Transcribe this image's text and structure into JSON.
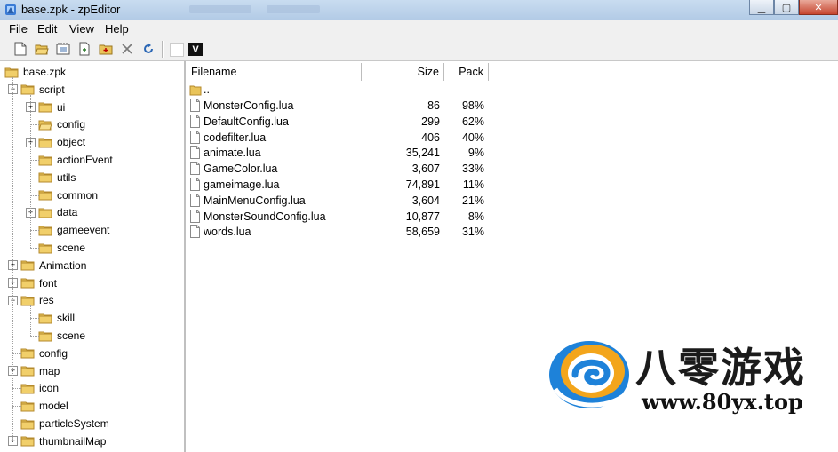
{
  "window": {
    "title": "base.zpk - zpEditor"
  },
  "menu": [
    "File",
    "Edit",
    "View",
    "Help"
  ],
  "toolbar": {
    "v_label": "V"
  },
  "tree": [
    {
      "label": "base.zpk",
      "depth": 0,
      "expander": "none",
      "selected": false
    },
    {
      "label": "script",
      "depth": 1,
      "expander": "minus",
      "selected": false
    },
    {
      "label": "ui",
      "depth": 2,
      "expander": "plus",
      "selected": false
    },
    {
      "label": "config",
      "depth": 2,
      "expander": "none",
      "selected": true
    },
    {
      "label": "object",
      "depth": 2,
      "expander": "plus",
      "selected": false
    },
    {
      "label": "actionEvent",
      "depth": 2,
      "expander": "none",
      "selected": false
    },
    {
      "label": "utils",
      "depth": 2,
      "expander": "none",
      "selected": false
    },
    {
      "label": "common",
      "depth": 2,
      "expander": "none",
      "selected": false
    },
    {
      "label": "data",
      "depth": 2,
      "expander": "plus",
      "selected": false
    },
    {
      "label": "gameevent",
      "depth": 2,
      "expander": "none",
      "selected": false
    },
    {
      "label": "scene",
      "depth": 2,
      "expander": "none",
      "selected": false
    },
    {
      "label": "Animation",
      "depth": 1,
      "expander": "plus",
      "selected": false
    },
    {
      "label": "font",
      "depth": 1,
      "expander": "plus",
      "selected": false
    },
    {
      "label": "res",
      "depth": 1,
      "expander": "minus",
      "selected": false
    },
    {
      "label": "skill",
      "depth": 2,
      "expander": "none",
      "selected": false
    },
    {
      "label": "scene",
      "depth": 2,
      "expander": "none",
      "selected": false
    },
    {
      "label": "config",
      "depth": 1,
      "expander": "none",
      "selected": false
    },
    {
      "label": "map",
      "depth": 1,
      "expander": "plus",
      "selected": false
    },
    {
      "label": "icon",
      "depth": 1,
      "expander": "none",
      "selected": false
    },
    {
      "label": "model",
      "depth": 1,
      "expander": "none",
      "selected": false
    },
    {
      "label": "particleSystem",
      "depth": 1,
      "expander": "none",
      "selected": false
    },
    {
      "label": "thumbnailMap",
      "depth": 1,
      "expander": "plus",
      "selected": false
    }
  ],
  "list": {
    "columns": [
      "Filename",
      "Size",
      "Pack"
    ],
    "parent": "..",
    "rows": [
      {
        "name": "MonsterConfig.lua",
        "size": "86",
        "pack": "98%"
      },
      {
        "name": "DefaultConfig.lua",
        "size": "299",
        "pack": "62%"
      },
      {
        "name": "codefilter.lua",
        "size": "406",
        "pack": "40%"
      },
      {
        "name": "animate.lua",
        "size": "35,241",
        "pack": "9%"
      },
      {
        "name": "GameColor.lua",
        "size": "3,607",
        "pack": "33%"
      },
      {
        "name": "gameimage.lua",
        "size": "74,891",
        "pack": "11%"
      },
      {
        "name": "MainMenuConfig.lua",
        "size": "3,604",
        "pack": "21%"
      },
      {
        "name": "MonsterSoundConfig.lua",
        "size": "10,877",
        "pack": "8%"
      },
      {
        "name": "words.lua",
        "size": "58,659",
        "pack": "31%"
      }
    ]
  },
  "watermark": {
    "title": "八零游戏",
    "url": "www.80yx.top"
  },
  "colors": {
    "folder": "#e9c45a",
    "folder_dark": "#c79a2c",
    "titlebar": "#c9dcf0"
  }
}
